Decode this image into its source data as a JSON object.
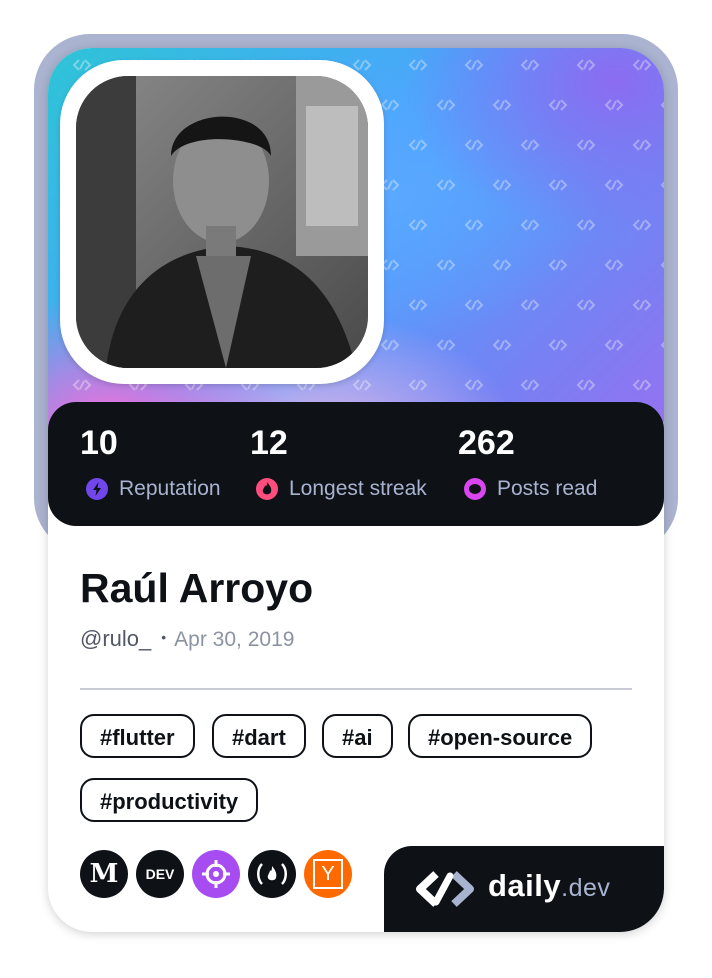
{
  "profile": {
    "name": "Raúl Arroyo",
    "handle": "@rulo_",
    "separator": "•",
    "joined": "Apr 30, 2019"
  },
  "stats": [
    {
      "value": "10",
      "label": "Reputation",
      "icon": "bolt-icon",
      "color": "#7147ed"
    },
    {
      "value": "12",
      "label": "Longest streak",
      "icon": "flame-icon",
      "color": "#ff4d7d"
    },
    {
      "value": "262",
      "label": "Posts read",
      "icon": "eye-icon",
      "color": "#d946ef"
    }
  ],
  "tags": [
    "#flutter",
    "#dart",
    "#ai",
    "#open-source",
    "#productivity"
  ],
  "sources": [
    {
      "name": "Medium",
      "glyph": "M",
      "color": "#0e1217",
      "icon": "medium-icon"
    },
    {
      "name": "DEV",
      "glyph": "DEV",
      "color": "#0e1217",
      "icon": "dev-icon"
    },
    {
      "name": "daily.dev community",
      "glyph": "",
      "color": "#a64cf0",
      "icon": "crosshair-icon"
    },
    {
      "name": "freeCodeCamp",
      "glyph": "(🔥)",
      "color": "#0e1217",
      "icon": "freecodecamp-icon"
    },
    {
      "name": "Hacker News",
      "glyph": "Y",
      "color": "#ff6a00",
      "icon": "hackernews-icon"
    }
  ],
  "brand": {
    "name": "daily",
    "suffix": ".dev"
  },
  "colors": {
    "card_bg": "#ffffff",
    "dark": "#0e1217",
    "muted": "#a8b3cf",
    "frame": "#aab3cf"
  }
}
